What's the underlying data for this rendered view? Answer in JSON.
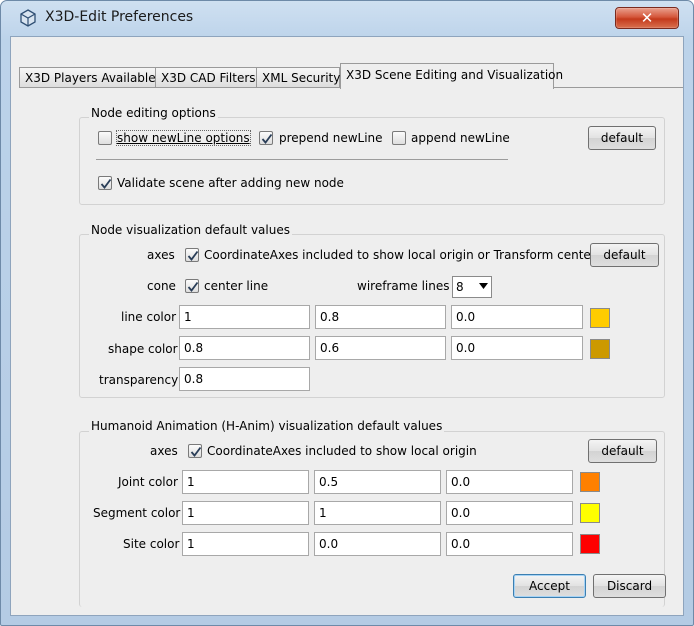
{
  "window": {
    "title": "X3D-Edit Preferences",
    "close_glyph": "✕"
  },
  "tabs": [
    {
      "label": "X3D Players Available"
    },
    {
      "label": "X3D CAD Filters"
    },
    {
      "label": "XML Security"
    },
    {
      "label": "X3D Scene Editing and Visualization"
    }
  ],
  "node_editing": {
    "title": "Node editing options",
    "show_newline": {
      "label": "show newLine options",
      "checked": false
    },
    "prepend_newline": {
      "label": "prepend newLine",
      "checked": true
    },
    "append_newline": {
      "label": "append newLine",
      "checked": false
    },
    "default_label": "default",
    "validate": {
      "label": "Validate scene after adding new node",
      "checked": true
    }
  },
  "node_vis": {
    "title": "Node visualization default values",
    "axes_label": "axes",
    "axes_cb_label": "CoordinateAxes included to show local origin or Transform center",
    "default_label": "default",
    "cone_label": "cone",
    "center_line_label": "center line",
    "wireframe_label": "wireframe lines",
    "wireframe_value": "8",
    "line_color": {
      "label": "line color",
      "values": [
        "1",
        "0.8",
        "0.0"
      ],
      "swatch": "#ffcc00"
    },
    "shape_color": {
      "label": "shape color",
      "values": [
        "0.8",
        "0.6",
        "0.0"
      ],
      "swatch": "#cc9900"
    },
    "transparency": {
      "label": "transparency",
      "value": "0.8"
    }
  },
  "hanim": {
    "title": "Humanoid Animation (H-Anim) visualization default values",
    "axes_label": "axes",
    "axes_cb_label": "CoordinateAxes included to show local origin",
    "default_label": "default",
    "joint_color": {
      "label": "Joint color",
      "values": [
        "1",
        "0.5",
        "0.0"
      ],
      "swatch": "#ff8000"
    },
    "segment_color": {
      "label": "Segment color",
      "values": [
        "1",
        "1",
        "0.0"
      ],
      "swatch": "#ffff00"
    },
    "site_color": {
      "label": "Site color",
      "values": [
        "1",
        "0.0",
        "0.0"
      ],
      "swatch": "#ff0000"
    }
  },
  "actions": {
    "accept": "Accept",
    "discard": "Discard"
  }
}
